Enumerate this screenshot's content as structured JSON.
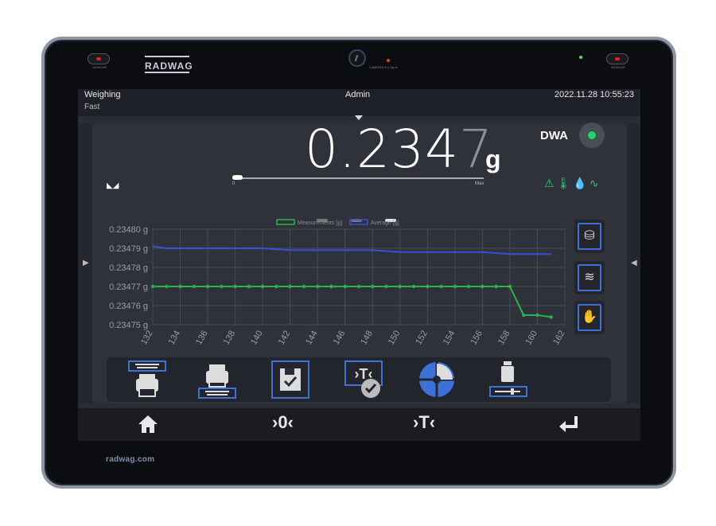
{
  "device": {
    "brand": "RADWAG",
    "sensor_label": "SENSOR",
    "camera_label": "CAMERA 8.0 Mpix",
    "website": "radwag.com"
  },
  "header": {
    "mode": "Weighing",
    "submode": "Fast",
    "user": "Admin",
    "datetime": "2022.11.28 10:55:23"
  },
  "reading": {
    "value_main": "0.234",
    "value_last": "7",
    "unit": "g",
    "dwa_label": "DWA",
    "range_min": "0",
    "range_max": "Max",
    "range_fill_fraction": 0.04
  },
  "colors": {
    "measurements": "#27b24a",
    "average": "#3a4ed6",
    "accent": "#3c72d8",
    "status_green": "#2ecc71"
  },
  "chart_data": {
    "type": "line",
    "legend": [
      "Measurements [g]",
      "Average [g]"
    ],
    "legend_placement": "top",
    "grid": true,
    "x_ticks": [
      132,
      134,
      136,
      138,
      140,
      142,
      144,
      146,
      148,
      150,
      152,
      154,
      156,
      158,
      160,
      162
    ],
    "y_ticks": [
      "0.23480 g",
      "0.23479 g",
      "0.23478 g",
      "0.23477 g",
      "0.23476 g",
      "0.23475 g"
    ],
    "xlim": [
      132,
      162
    ],
    "ylim": [
      0.23475,
      0.2348
    ],
    "series": [
      {
        "name": "Measurements [g]",
        "x": [
          132,
          133,
          134,
          135,
          136,
          137,
          138,
          139,
          140,
          141,
          142,
          143,
          144,
          145,
          146,
          147,
          148,
          149,
          150,
          151,
          152,
          153,
          154,
          155,
          156,
          157,
          158,
          159,
          160,
          161
        ],
        "y": [
          0.23477,
          0.23477,
          0.23477,
          0.23477,
          0.23477,
          0.23477,
          0.23477,
          0.23477,
          0.23477,
          0.23477,
          0.23477,
          0.23477,
          0.23477,
          0.23477,
          0.23477,
          0.23477,
          0.23477,
          0.23477,
          0.23477,
          0.23477,
          0.23477,
          0.23477,
          0.23477,
          0.23477,
          0.23477,
          0.23477,
          0.23477,
          0.234755,
          0.234755,
          0.234754
        ]
      },
      {
        "name": "Average [g]",
        "x": [
          132,
          133,
          136,
          140,
          142,
          148,
          150,
          156,
          158,
          161
        ],
        "y": [
          0.234791,
          0.23479,
          0.23479,
          0.23479,
          0.234789,
          0.234789,
          0.234788,
          0.234788,
          0.234787,
          0.234787
        ]
      }
    ]
  },
  "side_buttons": [
    {
      "icon": "weight-database-icon"
    },
    {
      "icon": "temperature-icon"
    },
    {
      "icon": "hand-wireless-icon"
    }
  ],
  "toolbar": [
    {
      "icon": "print-header-icon"
    },
    {
      "icon": "print-footer-icon"
    },
    {
      "icon": "save-record-icon"
    },
    {
      "icon": "tare-confirm-icon"
    },
    {
      "icon": "program-dial-icon"
    },
    {
      "icon": "weight-settings-icon"
    }
  ],
  "nav": [
    {
      "icon": "home-icon"
    },
    {
      "icon": "zero-icon",
      "label": "›0‹"
    },
    {
      "icon": "tare-icon",
      "label": "›T‹"
    },
    {
      "icon": "enter-icon"
    }
  ]
}
